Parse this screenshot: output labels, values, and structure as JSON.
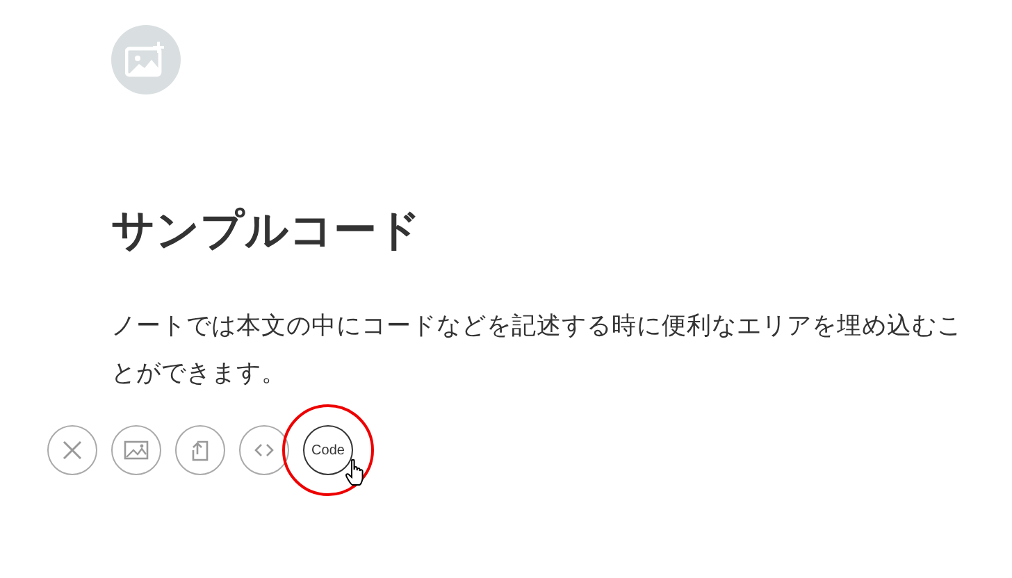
{
  "title": "サンプルコード",
  "body": "ノートでは本文の中にコードなどを記述する時に便利なエリアを埋め込むことができます。",
  "toolbar": [
    {
      "kind": "close"
    },
    {
      "kind": "image"
    },
    {
      "kind": "upload"
    },
    {
      "kind": "embed"
    },
    {
      "kind": "code",
      "label": "Code",
      "highlighted": true
    }
  ]
}
